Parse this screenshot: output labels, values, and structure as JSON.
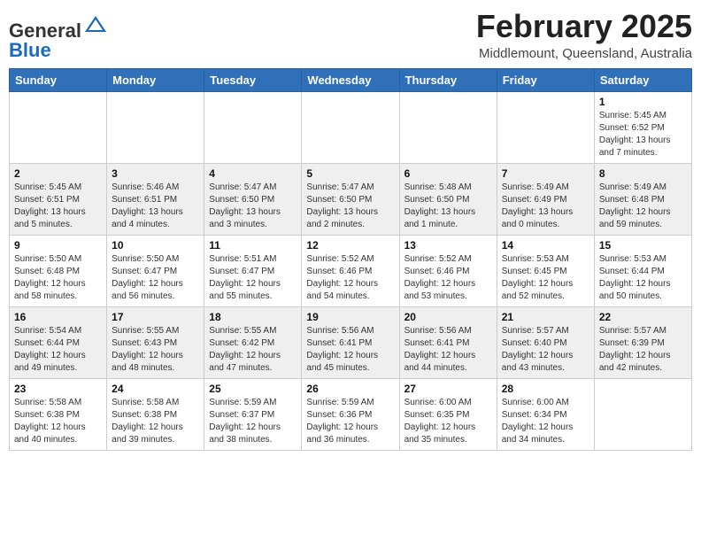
{
  "header": {
    "logo_general": "General",
    "logo_blue": "Blue",
    "month_title": "February 2025",
    "location": "Middlemount, Queensland, Australia"
  },
  "days_of_week": [
    "Sunday",
    "Monday",
    "Tuesday",
    "Wednesday",
    "Thursday",
    "Friday",
    "Saturday"
  ],
  "weeks": [
    [
      {
        "day": "",
        "info": ""
      },
      {
        "day": "",
        "info": ""
      },
      {
        "day": "",
        "info": ""
      },
      {
        "day": "",
        "info": ""
      },
      {
        "day": "",
        "info": ""
      },
      {
        "day": "",
        "info": ""
      },
      {
        "day": "1",
        "info": "Sunrise: 5:45 AM\nSunset: 6:52 PM\nDaylight: 13 hours\nand 7 minutes."
      }
    ],
    [
      {
        "day": "2",
        "info": "Sunrise: 5:45 AM\nSunset: 6:51 PM\nDaylight: 13 hours\nand 5 minutes."
      },
      {
        "day": "3",
        "info": "Sunrise: 5:46 AM\nSunset: 6:51 PM\nDaylight: 13 hours\nand 4 minutes."
      },
      {
        "day": "4",
        "info": "Sunrise: 5:47 AM\nSunset: 6:50 PM\nDaylight: 13 hours\nand 3 minutes."
      },
      {
        "day": "5",
        "info": "Sunrise: 5:47 AM\nSunset: 6:50 PM\nDaylight: 13 hours\nand 2 minutes."
      },
      {
        "day": "6",
        "info": "Sunrise: 5:48 AM\nSunset: 6:50 PM\nDaylight: 13 hours\nand 1 minute."
      },
      {
        "day": "7",
        "info": "Sunrise: 5:49 AM\nSunset: 6:49 PM\nDaylight: 13 hours\nand 0 minutes."
      },
      {
        "day": "8",
        "info": "Sunrise: 5:49 AM\nSunset: 6:48 PM\nDaylight: 12 hours\nand 59 minutes."
      }
    ],
    [
      {
        "day": "9",
        "info": "Sunrise: 5:50 AM\nSunset: 6:48 PM\nDaylight: 12 hours\nand 58 minutes."
      },
      {
        "day": "10",
        "info": "Sunrise: 5:50 AM\nSunset: 6:47 PM\nDaylight: 12 hours\nand 56 minutes."
      },
      {
        "day": "11",
        "info": "Sunrise: 5:51 AM\nSunset: 6:47 PM\nDaylight: 12 hours\nand 55 minutes."
      },
      {
        "day": "12",
        "info": "Sunrise: 5:52 AM\nSunset: 6:46 PM\nDaylight: 12 hours\nand 54 minutes."
      },
      {
        "day": "13",
        "info": "Sunrise: 5:52 AM\nSunset: 6:46 PM\nDaylight: 12 hours\nand 53 minutes."
      },
      {
        "day": "14",
        "info": "Sunrise: 5:53 AM\nSunset: 6:45 PM\nDaylight: 12 hours\nand 52 minutes."
      },
      {
        "day": "15",
        "info": "Sunrise: 5:53 AM\nSunset: 6:44 PM\nDaylight: 12 hours\nand 50 minutes."
      }
    ],
    [
      {
        "day": "16",
        "info": "Sunrise: 5:54 AM\nSunset: 6:44 PM\nDaylight: 12 hours\nand 49 minutes."
      },
      {
        "day": "17",
        "info": "Sunrise: 5:55 AM\nSunset: 6:43 PM\nDaylight: 12 hours\nand 48 minutes."
      },
      {
        "day": "18",
        "info": "Sunrise: 5:55 AM\nSunset: 6:42 PM\nDaylight: 12 hours\nand 47 minutes."
      },
      {
        "day": "19",
        "info": "Sunrise: 5:56 AM\nSunset: 6:41 PM\nDaylight: 12 hours\nand 45 minutes."
      },
      {
        "day": "20",
        "info": "Sunrise: 5:56 AM\nSunset: 6:41 PM\nDaylight: 12 hours\nand 44 minutes."
      },
      {
        "day": "21",
        "info": "Sunrise: 5:57 AM\nSunset: 6:40 PM\nDaylight: 12 hours\nand 43 minutes."
      },
      {
        "day": "22",
        "info": "Sunrise: 5:57 AM\nSunset: 6:39 PM\nDaylight: 12 hours\nand 42 minutes."
      }
    ],
    [
      {
        "day": "23",
        "info": "Sunrise: 5:58 AM\nSunset: 6:38 PM\nDaylight: 12 hours\nand 40 minutes."
      },
      {
        "day": "24",
        "info": "Sunrise: 5:58 AM\nSunset: 6:38 PM\nDaylight: 12 hours\nand 39 minutes."
      },
      {
        "day": "25",
        "info": "Sunrise: 5:59 AM\nSunset: 6:37 PM\nDaylight: 12 hours\nand 38 minutes."
      },
      {
        "day": "26",
        "info": "Sunrise: 5:59 AM\nSunset: 6:36 PM\nDaylight: 12 hours\nand 36 minutes."
      },
      {
        "day": "27",
        "info": "Sunrise: 6:00 AM\nSunset: 6:35 PM\nDaylight: 12 hours\nand 35 minutes."
      },
      {
        "day": "28",
        "info": "Sunrise: 6:00 AM\nSunset: 6:34 PM\nDaylight: 12 hours\nand 34 minutes."
      },
      {
        "day": "",
        "info": ""
      }
    ]
  ]
}
